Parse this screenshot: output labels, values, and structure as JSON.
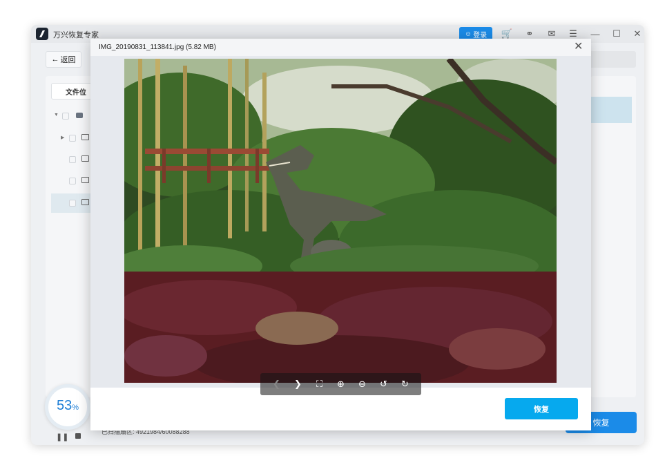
{
  "app": {
    "title": "万兴恢复专家",
    "login_label": "登录",
    "back_label": "返回",
    "file_tab_label": "文件位",
    "scan_status": "已扫描扇区: 4921984/60088288",
    "recover_label": "恢复"
  },
  "progress": {
    "value": "53",
    "unit": "%"
  },
  "modal": {
    "title": "IMG_20190831_113841.jpg (5.82 MB)",
    "recover_label": "恢复"
  },
  "icons": [
    "app-logo-icon",
    "user-icon",
    "cart-icon",
    "headset-icon",
    "mail-icon",
    "menu-icon",
    "minimize-icon",
    "maximize-icon",
    "close-icon",
    "arrow-left-icon",
    "prev-icon",
    "next-icon",
    "fullscreen-icon",
    "zoom-in-icon",
    "zoom-out-icon",
    "rotate-left-icon",
    "rotate-right-icon",
    "pause-icon",
    "stop-icon"
  ],
  "colors": {
    "accent": "#1b8be8",
    "modal_button": "#06a9ee",
    "progress_text": "#1f7fd6"
  }
}
